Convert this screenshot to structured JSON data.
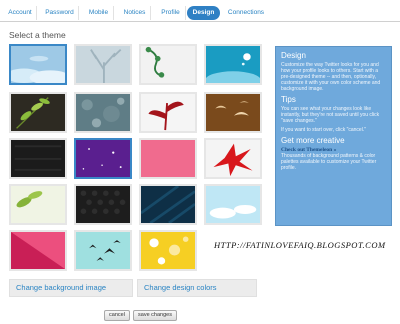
{
  "tabs": [
    {
      "label": "Account"
    },
    {
      "label": "Password"
    },
    {
      "label": "Mobile"
    },
    {
      "label": "Notices"
    },
    {
      "label": "Profile"
    },
    {
      "label": "Design",
      "active": true
    },
    {
      "label": "Connections"
    }
  ],
  "section_title": "Select a theme",
  "themes": [
    {
      "name": "sky-clouds",
      "colors": [
        "#9ec9e6",
        "#d6ecf8"
      ]
    },
    {
      "name": "tree-mist",
      "colors": [
        "#a9bfcb",
        "#dfe8ed"
      ]
    },
    {
      "name": "green-vines",
      "colors": [
        "#f2f2f2",
        "#3a8a4a"
      ]
    },
    {
      "name": "teal-sparkle",
      "colors": [
        "#1a9cc2",
        "#b6e6f3"
      ]
    },
    {
      "name": "leaves-dark",
      "colors": [
        "#2d2a22",
        "#8bbd3c"
      ]
    },
    {
      "name": "grey-pattern",
      "colors": [
        "#5f7d86",
        "#92aab0"
      ]
    },
    {
      "name": "red-plant",
      "colors": [
        "#f5f5f5",
        "#a3141b"
      ]
    },
    {
      "name": "brown-birds",
      "colors": [
        "#7a4a1c",
        "#e8c89a"
      ]
    },
    {
      "name": "black-texture",
      "colors": [
        "#1b1b1b",
        "#333333"
      ]
    },
    {
      "name": "purple-stars",
      "colors": [
        "#5a1f8f",
        "#8b4cc4"
      ]
    },
    {
      "name": "pink-solid",
      "colors": [
        "#f06b8e",
        "#f79ab2"
      ]
    },
    {
      "name": "red-flowers",
      "colors": [
        "#f4f4f4",
        "#d8171c"
      ]
    },
    {
      "name": "green-leaves",
      "colors": [
        "#f0f4e4",
        "#86b33a"
      ]
    },
    {
      "name": "dark-hex",
      "colors": [
        "#1d1d1d",
        "#3a3a3a"
      ]
    },
    {
      "name": "navy-stripes",
      "colors": [
        "#0e2f46",
        "#174a68"
      ]
    },
    {
      "name": "aqua-clouds",
      "colors": [
        "#bfe7f5",
        "#ffffff"
      ]
    },
    {
      "name": "magenta-triangle",
      "colors": [
        "#c91f56",
        "#ec4f7e"
      ]
    },
    {
      "name": "birds-teal",
      "colors": [
        "#9fe0e0",
        "#1c1c1c"
      ]
    },
    {
      "name": "yellow-flowers",
      "colors": [
        "#f6cf23",
        "#ffffff"
      ]
    }
  ],
  "buttons": {
    "change_background": "Change background image",
    "change_colors": "Change design colors",
    "cancel": "cancel",
    "save": "save changes"
  },
  "panel": {
    "design_heading": "Design",
    "design_text": "Customize the way Twitter looks for you and how your profile looks to others. Start with a pre-designed theme -- and then, optionally, customize it with your own color scheme and background image.",
    "tips_heading": "Tips",
    "tips_text_1": "You can see what your changes look like instantly, but they're not saved until you click \"save changes.\"",
    "tips_text_2": "If you want to start over, click \"cancel.\"",
    "more_heading": "Get more creative",
    "more_link": "Check out Themeleon »",
    "more_text": "Thousands of background patterns & color palettes available to customize your Twitter profile."
  },
  "watermark": "HTTP://FATINLOVEFAIQ.BLOGSPOT.COM"
}
